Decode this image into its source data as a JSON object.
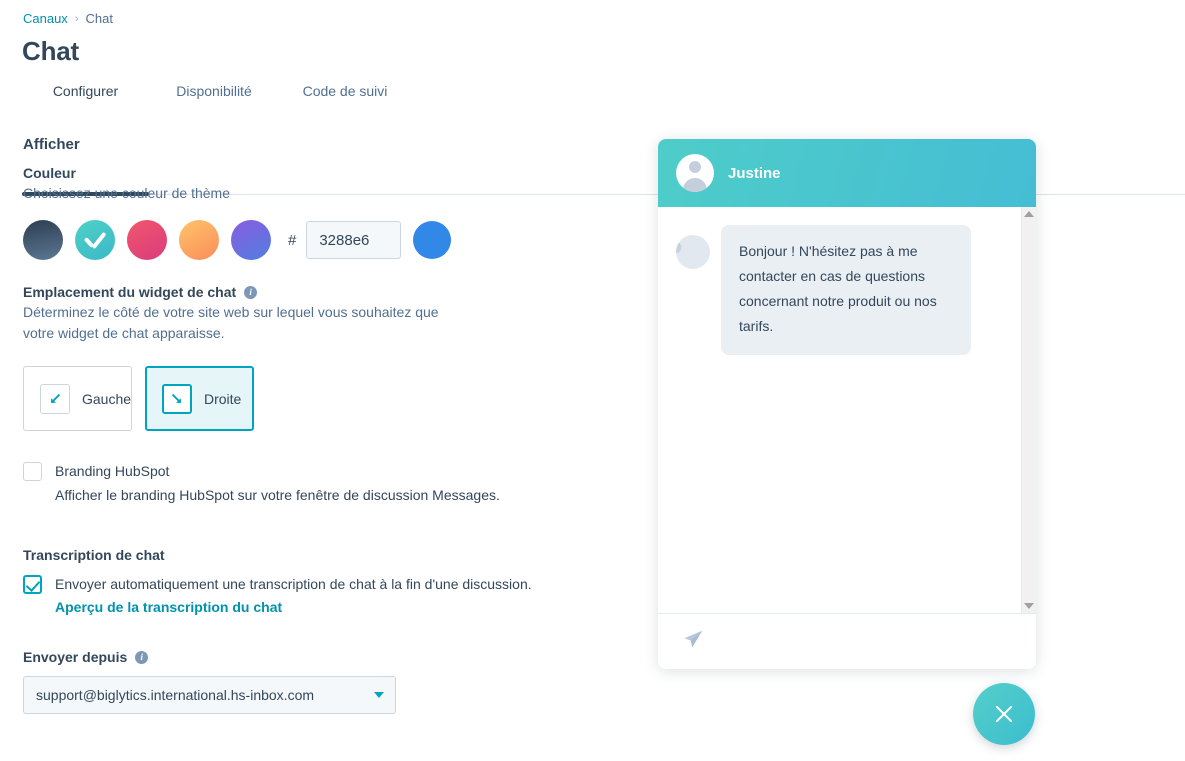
{
  "breadcrumb": {
    "parent": "Canaux",
    "separator": "›",
    "current": "Chat"
  },
  "page_title": "Chat",
  "tabs": [
    {
      "label": "Configurer",
      "active": true
    },
    {
      "label": "Disponibilité",
      "active": false
    },
    {
      "label": "Code de suivi",
      "active": false
    }
  ],
  "display_section": {
    "heading": "Afficher",
    "color": {
      "label": "Couleur",
      "description": "Choisissez une couleur de thème",
      "swatches": [
        {
          "name": "dark-slate",
          "from": "#2d3e50",
          "to": "#5b7894",
          "selected": false
        },
        {
          "name": "teal",
          "from": "#4fd1c5",
          "to": "#3bb8c9",
          "selected": true
        },
        {
          "name": "pink-red",
          "from": "#f2576b",
          "to": "#d93b7e",
          "selected": false
        },
        {
          "name": "orange",
          "from": "#ffc46b",
          "to": "#fb8c5a",
          "selected": false
        },
        {
          "name": "purple",
          "from": "#8b5ce0",
          "to": "#4f7fe0",
          "selected": false
        }
      ],
      "hash_symbol": "#",
      "hex_value": "3288e6",
      "hex_placeholder": "3288e6",
      "preview_color": "#3288e6"
    },
    "placement": {
      "label": "Emplacement du widget de chat",
      "info_glyph": "i",
      "description": "Déterminez le côté de votre site web sur lequel vous souhaitez que votre widget de chat apparaisse.",
      "options": [
        {
          "label": "Gauche",
          "icon": "arrow-down-left-icon",
          "selected": false
        },
        {
          "label": "Droite",
          "icon": "arrow-down-right-icon",
          "selected": true
        }
      ]
    },
    "branding": {
      "label": "Branding HubSpot",
      "description": "Afficher le branding HubSpot sur votre fenêtre de discussion Messages.",
      "checked": false
    }
  },
  "transcript_section": {
    "heading": "Transcription de chat",
    "checkbox_label": "Envoyer automatiquement une transcription de chat à la fin d'une discussion.",
    "checked": true,
    "link": "Aperçu de la transcription du chat"
  },
  "send_from": {
    "label": "Envoyer depuis",
    "info_glyph": "i",
    "selected_value": "support@biglytics.international.hs-inbox.com"
  },
  "chat_preview": {
    "agent_name": "Justine",
    "header_color_from": "#4ecdc9",
    "header_color_to": "#45bdd4",
    "messages": [
      {
        "author": "Justine",
        "text": "Bonjour ! N'hésitez pas à me contacter en cas de questions concernant notre produit ou nos tarifs."
      }
    ],
    "input_send_icon": "send-paper-plane-icon",
    "launcher_icon": "close-x-icon",
    "launcher_color": "#4ac9c9"
  }
}
